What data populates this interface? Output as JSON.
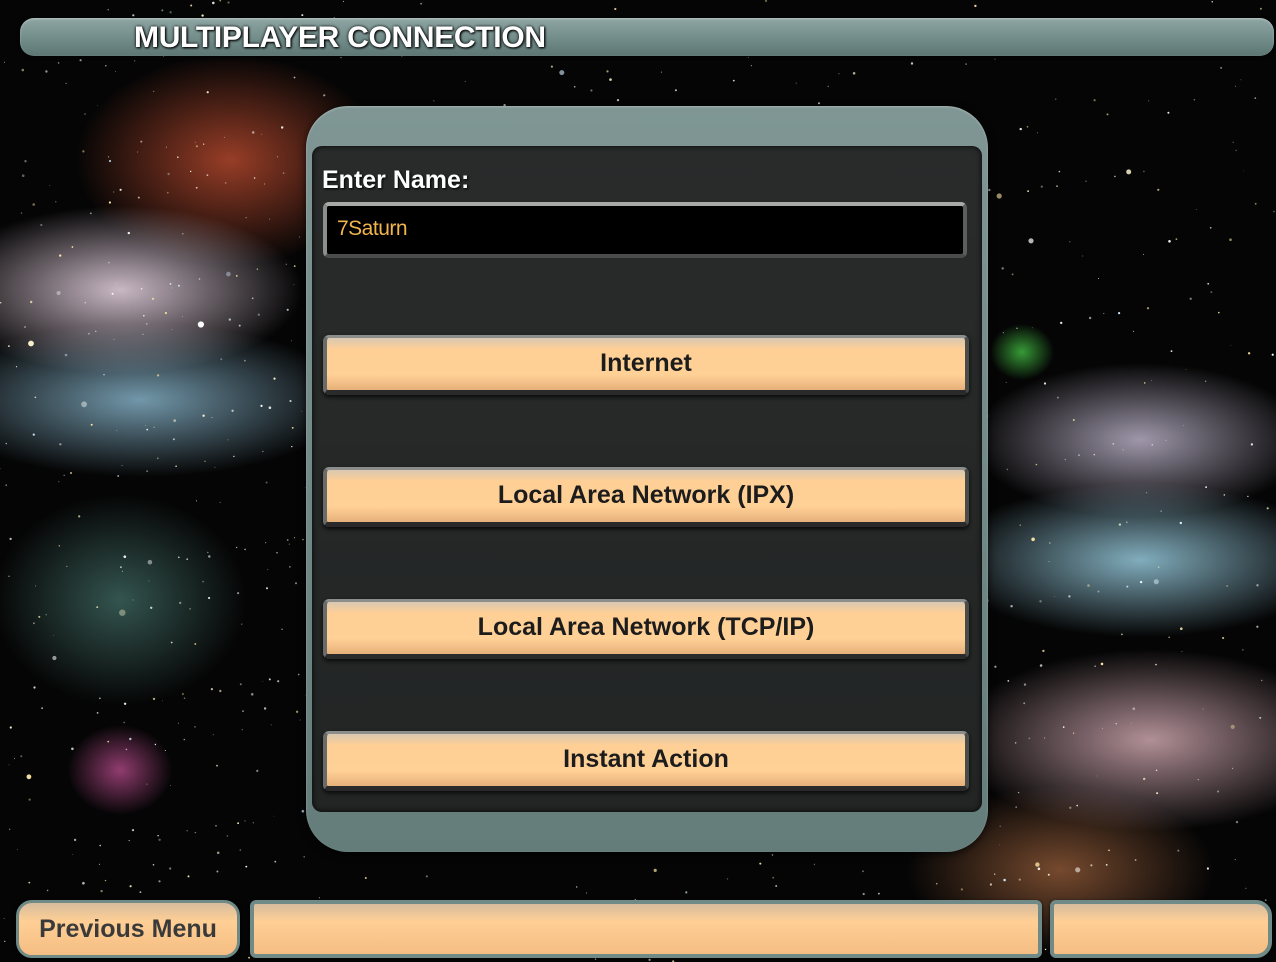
{
  "header": {
    "title": "MULTIPLAYER CONNECTION"
  },
  "panel": {
    "name_label": "Enter Name:",
    "name_value": "7Saturn",
    "buttons": [
      {
        "label": "Internet"
      },
      {
        "label": "Local Area Network (IPX)"
      },
      {
        "label": "Local Area Network (TCP/IP)"
      },
      {
        "label": "Instant Action"
      }
    ]
  },
  "footer": {
    "previous_label": "Previous Menu",
    "status_text": "",
    "side_text": ""
  },
  "colors": {
    "frame": "#6f8a87",
    "button_fill": "#ffcf95",
    "input_text": "#f1b54b",
    "label_text": "#ffffff"
  }
}
